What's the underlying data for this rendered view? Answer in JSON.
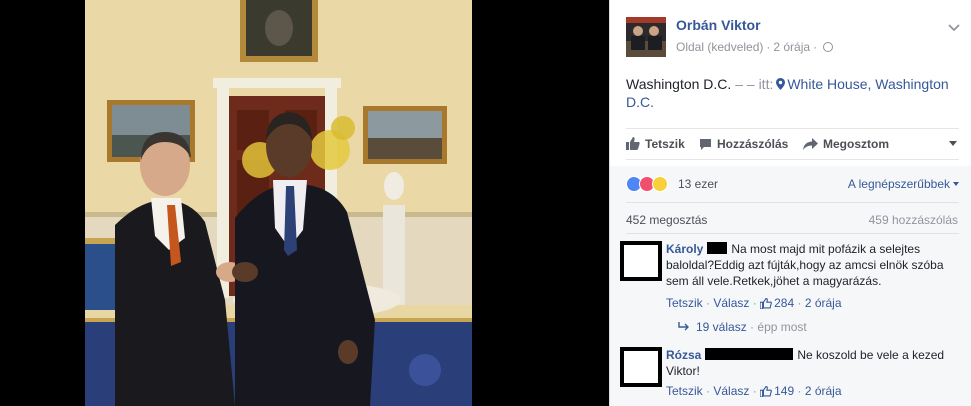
{
  "post": {
    "author": "Orbán Viktor",
    "meta_type": "Oldal (kedveled)",
    "meta_dot1": "·",
    "meta_time": "2 órája",
    "meta_dot2": "·",
    "location_prefix": "Washington D.C.",
    "location_dashes": "– –",
    "location_itt": "itt:",
    "location_link": "White House, Washington D.C."
  },
  "actions": {
    "like": "Tetszik",
    "comment": "Hozzászólás",
    "share": "Megosztom"
  },
  "reactions": {
    "count": "13 ezer",
    "sort_label": "A legnépszerűbbek",
    "colors": {
      "like": "#4e86f5",
      "love": "#f0506e",
      "haha": "#f7d13a"
    }
  },
  "stats": {
    "shares": "452 megosztás",
    "comments": "459 hozzászólás"
  },
  "comments": [
    {
      "author": "Károly",
      "text": "Na most majd mit pofázik a selejtes baloldal?Eddig azt fújták,hogy az amcsi elnök szóba sem áll vele.Retkek,jöhet a magyarázás.",
      "like": "Tetszik",
      "sep1": "·",
      "reply": "Válasz",
      "sep2": "·",
      "likes": "284",
      "sep3": "·",
      "time": "2 órája",
      "replies": "19 válasz",
      "replies_sep": "·",
      "replies_time": "épp most"
    },
    {
      "author": "Rózsa",
      "text": "Ne koszold be vele a kezed Viktor!",
      "like": "Tetszik",
      "sep1": "·",
      "reply": "Válasz",
      "sep2": "·",
      "likes": "149",
      "sep3": "·",
      "time": "2 órája"
    }
  ]
}
